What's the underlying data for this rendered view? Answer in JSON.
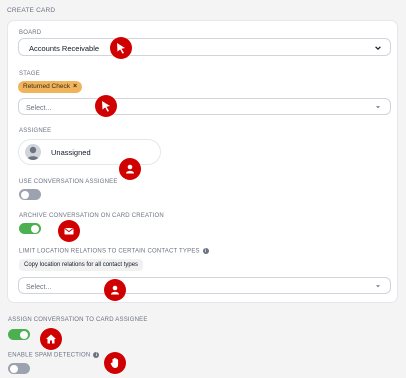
{
  "section": {
    "title": "CREATE CARD"
  },
  "board": {
    "label": "BOARD",
    "value": "Accounts Receivable"
  },
  "stage": {
    "label": "STAGE",
    "tag": "Returned Check",
    "placeholder": "Select..."
  },
  "assignee": {
    "label": "ASSIGNEE",
    "name": "Unassigned"
  },
  "use_conversation_assignee": {
    "label": "USE CONVERSATION ASSIGNEE",
    "enabled": false
  },
  "archive_conversation": {
    "label": "ARCHIVE CONVERSATION ON CARD CREATION",
    "enabled": true
  },
  "limit_location": {
    "label": "LIMIT LOCATION RELATIONS TO CERTAIN CONTACT TYPES",
    "copy_button": "Copy location relations for all contact types",
    "placeholder": "Select..."
  },
  "assign_conversation": {
    "label": "ASSIGN CONVERSATION TO CARD ASSIGNEE",
    "enabled": true
  },
  "spam_detection": {
    "label": "ENABLE SPAM DETECTION",
    "enabled": false
  },
  "colors": {
    "accent_green": "#4caf50",
    "tag_orange": "#f0b55c",
    "marker_red": "#d00000"
  }
}
